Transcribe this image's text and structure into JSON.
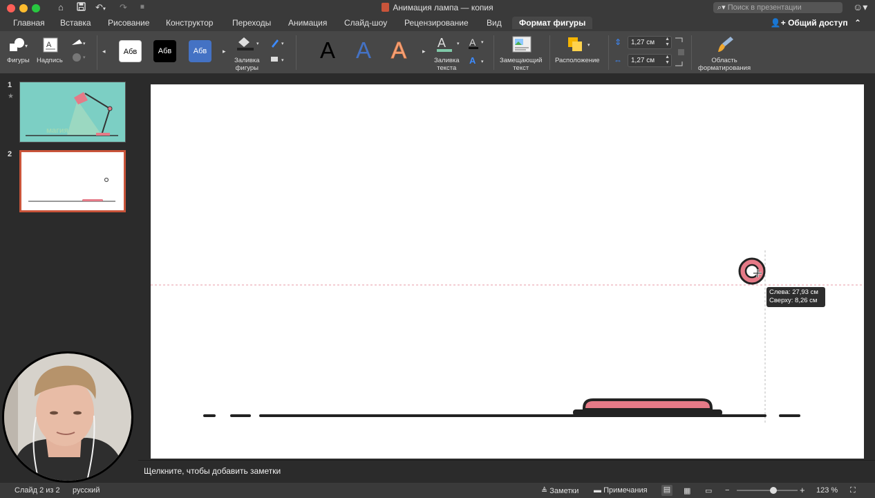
{
  "window": {
    "title": "Анимация лампа — копия",
    "search_placeholder": "Поиск в презентации"
  },
  "tabs": [
    {
      "label": "Главная"
    },
    {
      "label": "Вставка"
    },
    {
      "label": "Рисование"
    },
    {
      "label": "Конструктор"
    },
    {
      "label": "Переходы"
    },
    {
      "label": "Анимация"
    },
    {
      "label": "Слайд-шоу"
    },
    {
      "label": "Рецензирование"
    },
    {
      "label": "Вид"
    },
    {
      "label": "Формат фигуры",
      "active": true
    }
  ],
  "share_label": "Общий доступ",
  "ribbon": {
    "shapes_label": "Фигуры",
    "textbox_label": "Надпись",
    "style_samples": [
      "Абв",
      "Абв",
      "Абв"
    ],
    "shape_fill_label_1": "Заливка",
    "shape_fill_label_2": "фигуры",
    "wordart_letter": "A",
    "text_fill_label_1": "Заливка",
    "text_fill_label_2": "текста",
    "alt_text_label_1": "Замещающий",
    "alt_text_label_2": "текст",
    "arrange_label": "Расположение",
    "height_value": "1,27 см",
    "width_value": "1,27 см",
    "format_pane_label_1": "Область",
    "format_pane_label_2": "форматирования"
  },
  "slides": [
    {
      "number": "1",
      "thumb_text": "магия"
    },
    {
      "number": "2",
      "selected": true
    }
  ],
  "tooltip": {
    "left": "Слева: 27,93 см",
    "top": "Сверху: 8,26 см"
  },
  "notes_placeholder": "Щелкните, чтобы добавить заметки",
  "status": {
    "slide_info": "Слайд 2 из 2",
    "language": "русский",
    "notes_button": "Заметки",
    "comments_button": "Примечания",
    "zoom": "123 %",
    "zoom_level": 0.62
  },
  "colors": {
    "accent": "#c9543a",
    "pink": "#e57a87",
    "thumb_teal": "#7ccfc4"
  }
}
